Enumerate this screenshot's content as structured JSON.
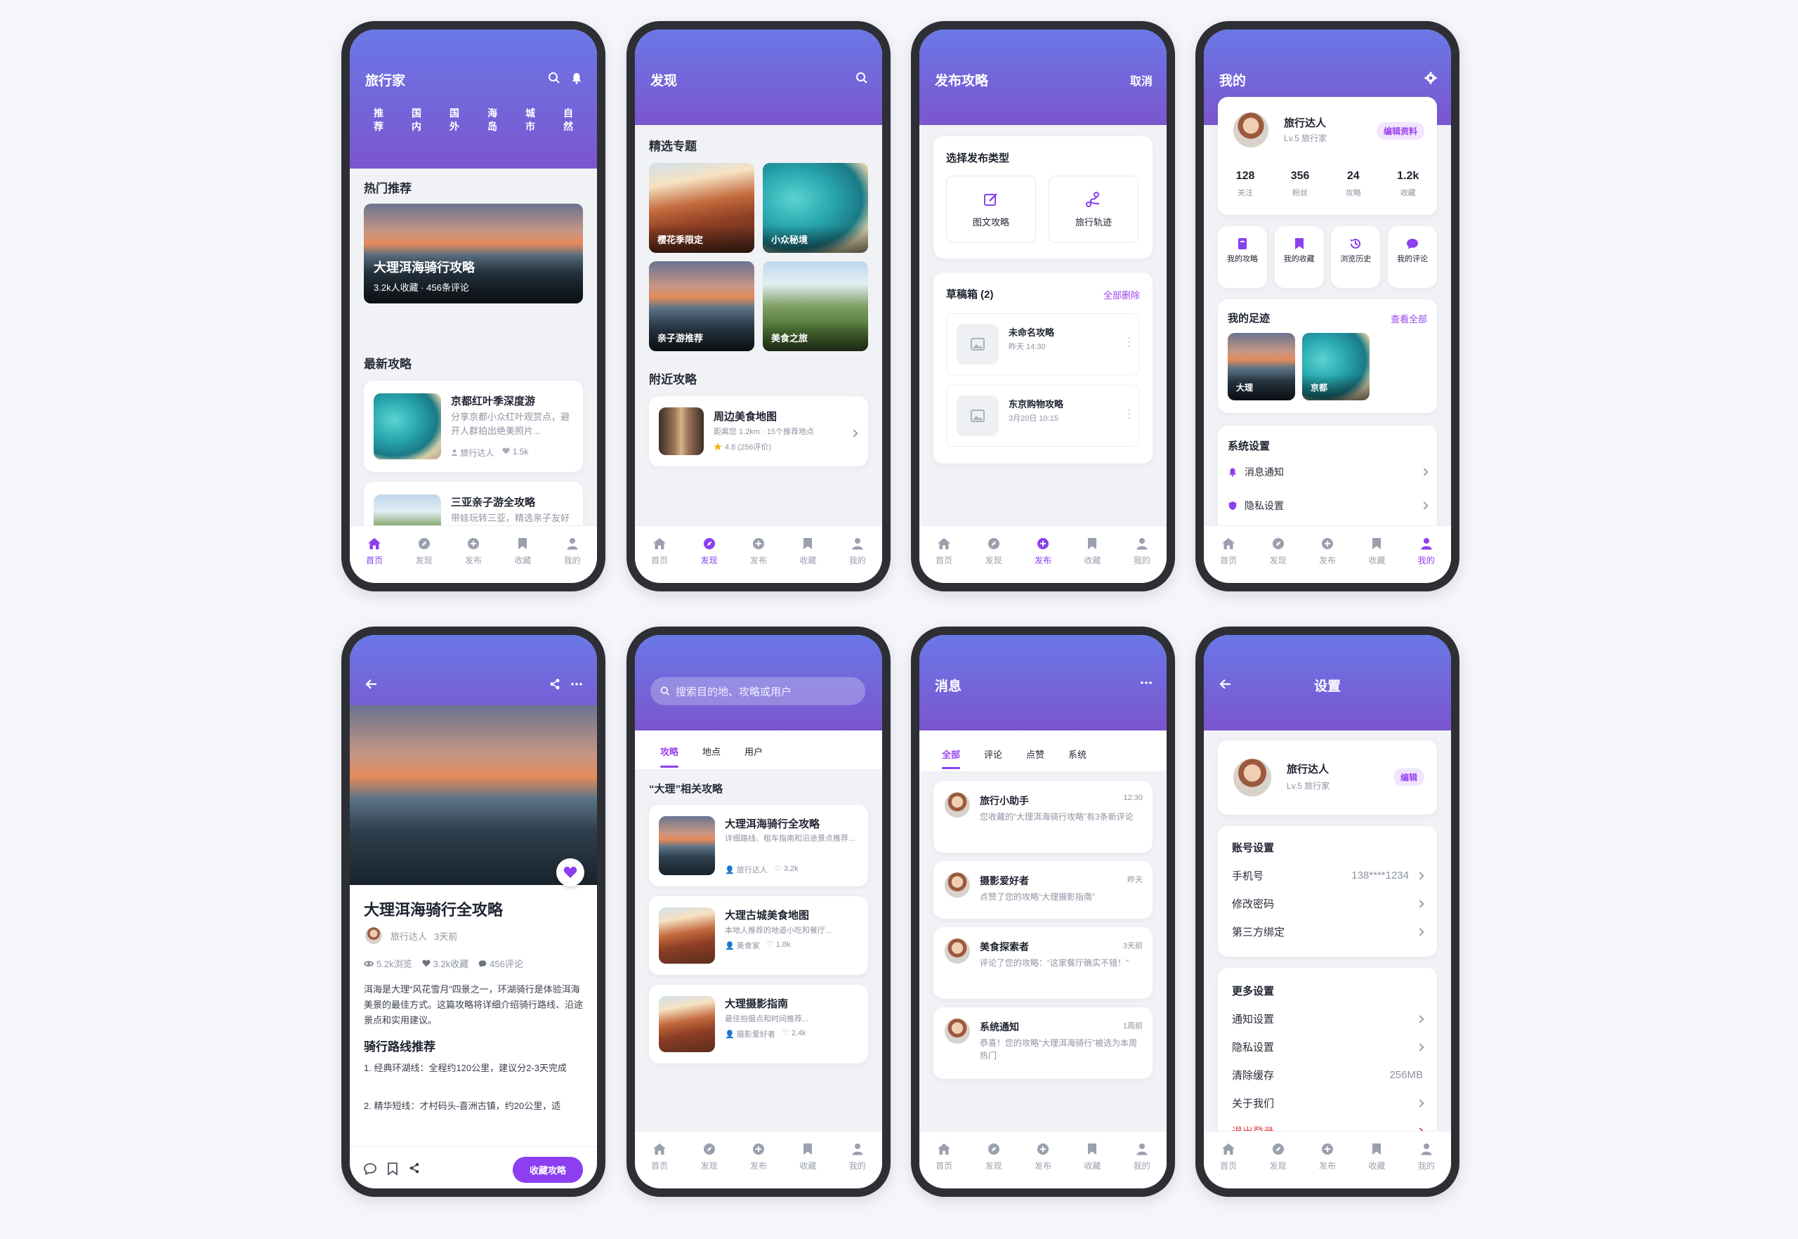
{
  "tabbar": [
    "首页",
    "发现",
    "发布",
    "收藏",
    "我的"
  ],
  "home": {
    "title": "旅行家",
    "categories": [
      "推荐",
      "国内",
      "国外",
      "海岛",
      "城市",
      "自然"
    ],
    "hot_title": "热门推荐",
    "hot_card": {
      "title": "大理洱海骑行攻略",
      "meta": "3.2k人收藏 · 456条评论"
    },
    "latest_title": "最新攻略",
    "articles": [
      {
        "title": "京都红叶季深度游",
        "desc": "分享京都小众红叶观赏点，避开人群拍出绝美照片...",
        "author": "旅行达人",
        "likes": "1.5k"
      },
      {
        "title": "三亚亲子游全攻略",
        "desc": "带娃玩转三亚，精选亲子友好酒店和景点...",
        "author": "",
        "likes": ""
      }
    ]
  },
  "discover": {
    "title": "发现",
    "topics_title": "精选专题",
    "topics": [
      "樱花季限定",
      "小众秘境",
      "亲子游推荐",
      "美食之旅"
    ],
    "nearby_title": "附近攻略",
    "nearby": {
      "title": "周边美食地图",
      "meta": "距离您 1.2km · 15个推荐地点",
      "rating": "4.8 (256评价)"
    }
  },
  "publish": {
    "title": "发布攻略",
    "cancel": "取消",
    "type_title": "选择发布类型",
    "types": [
      "图文攻略",
      "旅行轨迹"
    ],
    "drafts_title": "草稿箱 (2)",
    "delete_all": "全部删除",
    "drafts": [
      {
        "title": "未命名攻略",
        "time": "昨天 14:30"
      },
      {
        "title": "东京购物攻略",
        "time": "3月20日 10:15"
      }
    ]
  },
  "profile": {
    "title": "我的",
    "name": "旅行达人",
    "level": "Lv.5 旅行家",
    "edit": "编辑资料",
    "stats": [
      {
        "value": "128",
        "label": "关注"
      },
      {
        "value": "356",
        "label": "粉丝"
      },
      {
        "value": "24",
        "label": "攻略"
      },
      {
        "value": "1.2k",
        "label": "收藏"
      }
    ],
    "shortcuts": [
      "我的攻略",
      "我的收藏",
      "浏览历史",
      "我的评论"
    ],
    "footprint_title": "我的足迹",
    "view_all": "查看全部",
    "footprints": [
      "大理",
      "京都"
    ],
    "settings_title": "系统设置",
    "settings": [
      "消息通知",
      "隐私设置"
    ]
  },
  "detail": {
    "title": "大理洱海骑行全攻略",
    "author": "旅行达人",
    "time": "3天前",
    "views": "5.2k浏览",
    "favs": "3.2k收藏",
    "comments": "456评论",
    "body": "洱海是大理“风花雪月”四景之一，环湖骑行是体验洱海美景的最佳方式。这篇攻略将详细介绍骑行路线、沿途景点和实用建议。",
    "route_title": "骑行路线推荐",
    "route1": "1. 经典环湖线：全程约120公里，建议分2-3天完成",
    "route2": "2. 精华短线：才村码头-喜洲古镇，约20公里，适",
    "collect_btn": "收藏攻略"
  },
  "search": {
    "placeholder": "搜索目的地、攻略或用户",
    "tabs": [
      "攻略",
      "地点",
      "用户"
    ],
    "result_title": "“大理”相关攻略",
    "results": [
      {
        "title": "大理洱海骑行全攻略",
        "desc": "详细路线、租车指南和沿途景点推荐...",
        "author": "旅行达人",
        "likes": "3.2k"
      },
      {
        "title": "大理古城美食地图",
        "desc": "本地人推荐的地道小吃和餐厅...",
        "author": "美食家",
        "likes": "1.8k"
      },
      {
        "title": "大理摄影指南",
        "desc": "最佳拍摄点和时间推荐...",
        "author": "摄影爱好者",
        "likes": "2.4k"
      }
    ]
  },
  "messages": {
    "title": "消息",
    "tabs": [
      "全部",
      "评论",
      "点赞",
      "系统"
    ],
    "items": [
      {
        "name": "旅行小助手",
        "time": "12:30",
        "text": "您收藏的“大理洱海骑行攻略”有3条新评论"
      },
      {
        "name": "摄影爱好者",
        "time": "昨天",
        "text": "点赞了您的攻略“大理摄影指南”"
      },
      {
        "name": "美食探索者",
        "time": "3天前",
        "text": "评论了您的攻略：“这家餐厅确实不错！”"
      },
      {
        "name": "系统通知",
        "time": "1周前",
        "text": "恭喜！您的攻略“大理洱海骑行”被选为本周热门"
      }
    ]
  },
  "settings": {
    "title": "设置",
    "name": "旅行达人",
    "level": "Lv.5 旅行家",
    "edit": "编辑",
    "account_title": "账号设置",
    "phone_label": "手机号",
    "phone_value": "138****1234",
    "password": "修改密码",
    "third": "第三方绑定",
    "more_title": "更多设置",
    "notify": "通知设置",
    "privacy": "隐私设置",
    "cache": "清除缓存",
    "cache_value": "256MB",
    "about": "关于我们",
    "logout": "退出登录"
  },
  "colors": {
    "accent": "#8b3ff0",
    "header_top": "#6a78e6",
    "header_bottom": "#7c55cf",
    "danger": "#e5484d"
  }
}
